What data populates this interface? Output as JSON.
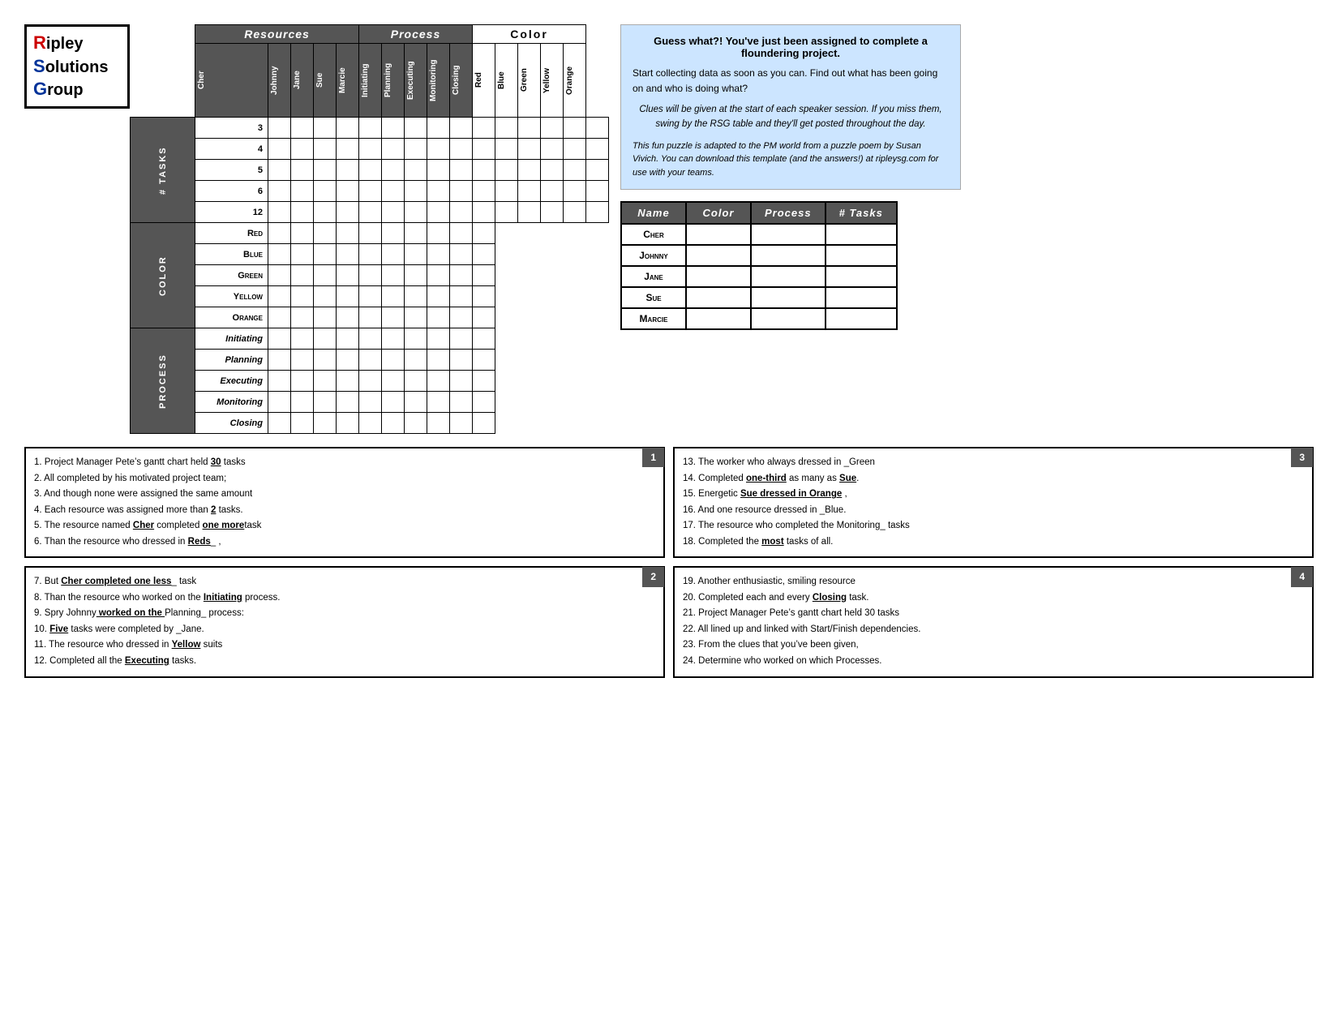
{
  "logo": {
    "line1": "ipley",
    "line2": "olutions",
    "line3": "roup",
    "r": "R",
    "s": "S",
    "g": "G"
  },
  "headers": {
    "resources": "Resources",
    "process": "Process",
    "color": "Color"
  },
  "columns": {
    "resources": [
      "Cher",
      "Johnny",
      "Jane",
      "Sue",
      "Marcie"
    ],
    "process": [
      "Initiating",
      "Planning",
      "Executing",
      "Monitoring",
      "Closing"
    ],
    "color": [
      "Red",
      "Blue",
      "Green",
      "Yellow",
      "Orange"
    ]
  },
  "row_groups": {
    "tasks": {
      "label": "# Tasks",
      "rows": [
        "3",
        "4",
        "5",
        "6",
        "12"
      ]
    },
    "color": {
      "label": "Color",
      "rows": [
        "Red",
        "Blue",
        "Green",
        "Yellow",
        "Orange"
      ]
    },
    "process": {
      "label": "Process",
      "rows": [
        "Initiating",
        "Planning",
        "Executing",
        "Monitoring",
        "Closing"
      ]
    }
  },
  "summary_table": {
    "headers": [
      "Name",
      "Color",
      "Process",
      "# Tasks"
    ],
    "rows": [
      {
        "name": "Cher",
        "color": "",
        "process": "",
        "tasks": ""
      },
      {
        "name": "Johnny",
        "color": "",
        "process": "",
        "tasks": ""
      },
      {
        "name": "Jane",
        "color": "",
        "process": "",
        "tasks": ""
      },
      {
        "name": "Sue",
        "color": "",
        "process": "",
        "tasks": ""
      },
      {
        "name": "Marcie",
        "color": "",
        "process": "",
        "tasks": ""
      }
    ]
  },
  "info_box": {
    "title": "Guess what?! You've just been assigned to complete a floundering project.",
    "body": "Start collecting data as soon as you can.  Find out what has been going on and who is doing what?",
    "italic1": "Clues will be given at the start of each speaker session.  If you miss them, swing by the RSG table and they'll get posted throughout the day.",
    "italic2": "This fun puzzle is adapted to the PM world from a puzzle poem by Susan Vivich.  You can download this template (and the answers!) at ripleysg.com for use with your teams."
  },
  "clue_boxes": [
    {
      "number": "1",
      "lines": [
        "1.  Project Manager Pete’s gantt chart held __30__ tasks",
        "2.  All completed by his motivated project team;",
        "3.  And though none were assigned the same amount",
        "4.  Each resource was assigned more than __2____ tasks.",
        "5.  The resource named __Cher__ completed _one more_task",
        "6.  Than the resource who dressed in __Reds___  ,"
      ]
    },
    {
      "number": "2",
      "lines": [
        "7.  But __Cher_ completed _one less_____ task",
        "8.  Than the resource who worked on the _Initiating_ process.",
        "9.  Spry __Johnny_ worked on the _Planning_ process:",
        "10. _Five_ tasks were completed by _Jane____.",
        "11. The resource who dressed in _Yellow_ suits",
        "12. Completed all the _Executing___ tasks."
      ]
    },
    {
      "number": "3",
      "lines": [
        "13. The worker who always dressed in _Green____",
        "14. Completed _one-third_ as many as _Sue_____.",
        "15. Energetic _Sue__ dressed in _Orange____ ,",
        "16. And one resource dressed in _Blue____.",
        "17. The resource who completed the __Monitoring_ tasks",
        "18. Completed the _most_ tasks of all."
      ]
    },
    {
      "number": "4",
      "lines": [
        "19. Another enthusiastic, smiling resource",
        "20. Completed each and every _Closing_____ task.",
        "21. Project Manager Pete’s gantt chart held 30 tasks",
        "22. All lined up and linked with Start/Finish dependencies.",
        "23. From the clues that you’ve been given,",
        "24. Determine who worked on which Processes."
      ]
    }
  ]
}
